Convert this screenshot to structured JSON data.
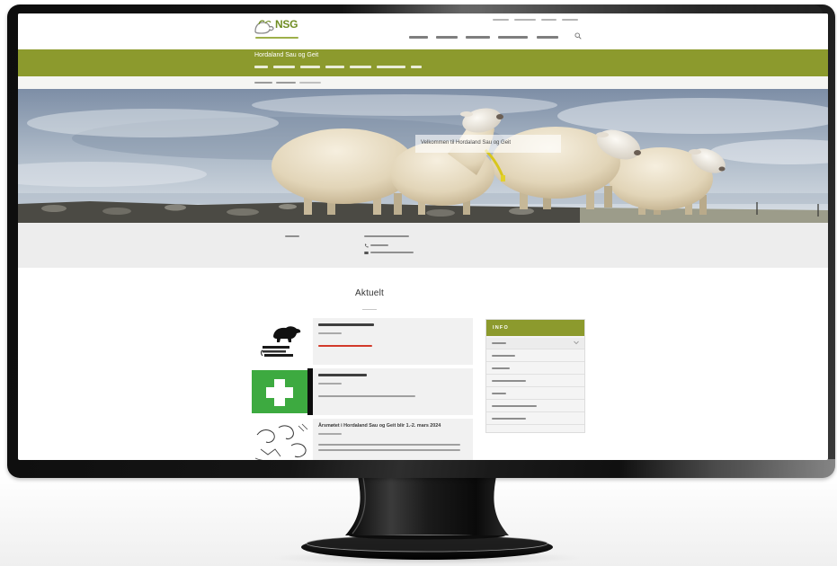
{
  "header": {
    "logo_text": "NSG"
  },
  "section_bar": {
    "title": "Hordaland Sau og Geit"
  },
  "hero": {
    "welcome_text": "Velkommen til Hordaland Sau og Geit"
  },
  "news": {
    "heading": "Aktuelt",
    "items": [
      {},
      {},
      {
        "title": "Årsmøtet i Hordaland Sau og Geit blir 1.-2. mars 2024"
      }
    ]
  },
  "sidebar": {
    "header": "INFO"
  },
  "icons": {
    "logo": "sheep-goat-logo-icon",
    "search": "search-icon",
    "phone": "phone-icon",
    "email": "email-icon",
    "chevron": "chevron-down-icon"
  },
  "colors": {
    "brand_green": "#8c9a2d",
    "logo_green": "#6f8d22",
    "alert_red": "#d23a2a",
    "cross_green": "#3daa40",
    "bezel": "#141414"
  }
}
